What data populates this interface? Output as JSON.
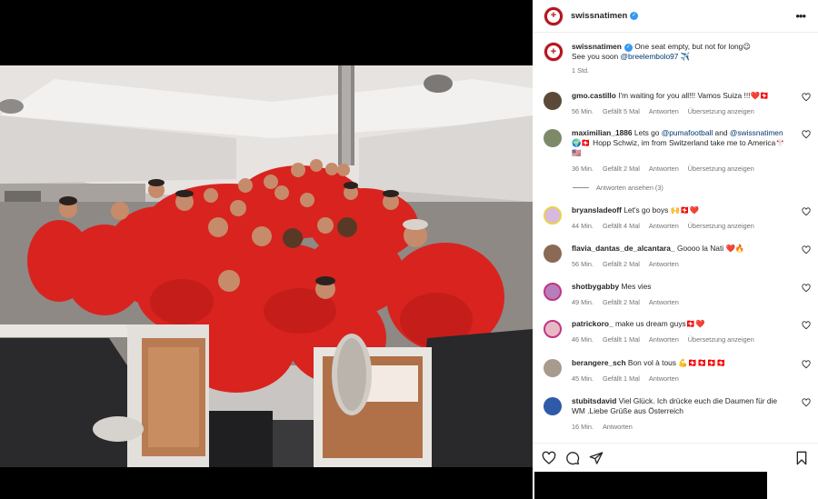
{
  "post": {
    "username": "swissnatimen",
    "caption_line1": "One seat empty, but not for long😉",
    "caption_line2_prefix": "See you soon ",
    "caption_mention": "@breelembolo97",
    "caption_line2_suffix": " ✈️",
    "time": "1 Std."
  },
  "comments": [
    {
      "user": "gmo.castillo",
      "text": "I'm waiting for you all!!! Vamos Suiza !!!❤️🇨🇭",
      "time": "56 Min.",
      "likes": "Gefällt 5 Mal",
      "reply": "Antworten",
      "translate": "Übersetzung anzeigen"
    },
    {
      "user": "maximilian_1886",
      "text_prefix": "Lets go ",
      "mention1": "@pumafootball",
      "text_mid": " and ",
      "mention2": "@swissnatimen",
      "text_suffix": " 🌍🇨🇭 Hopp Schwiz, im from Switzerland take me to America🎌🇺🇸",
      "time": "36 Min.",
      "likes": "Gefällt 2 Mal",
      "reply": "Antworten",
      "translate": "Übersetzung anzeigen",
      "replies_toggle": "Antworten ansehen (3)"
    },
    {
      "user": "bryansladeoff",
      "text": "Let's go boys 🙌🇨🇭❤️",
      "time": "44 Min.",
      "likes": "Gefällt 4 Mal",
      "reply": "Antworten",
      "translate": "Übersetzung anzeigen"
    },
    {
      "user": "flavia_dantas_de_alcantara_",
      "text": "Goooo la Nati ❤️🔥",
      "time": "56 Min.",
      "likes": "Gefällt 2 Mal",
      "reply": "Antworten"
    },
    {
      "user": "shotbygabby",
      "text": "Mes vies",
      "time": "49 Min.",
      "likes": "Gefällt 2 Mal",
      "reply": "Antworten"
    },
    {
      "user": "patrickoro_",
      "text": "make us dream guys🇨🇭❤️",
      "time": "46 Min.",
      "likes": "Gefällt 1 Mal",
      "reply": "Antworten",
      "translate": "Übersetzung anzeigen"
    },
    {
      "user": "berangere_sch",
      "text": "Bon vol à tous 💪🇨🇭🇨🇭🇨🇭🇨🇭",
      "time": "45 Min.",
      "likes": "Gefällt 1 Mal",
      "reply": "Antworten"
    },
    {
      "user": "stubitsdavid",
      "text": "Viel Glück. Ich drücke euch die Daumen für die WM .Liebe Grüße aus Österreich",
      "time": "16 Min.",
      "reply": "Antworten"
    }
  ],
  "icons": {
    "like": "heart-icon",
    "comment": "comment-icon",
    "share": "share-icon",
    "save": "bookmark-icon",
    "more": "more-options-icon",
    "verified": "verified-badge-icon"
  },
  "colors": {
    "jersey_red": "#d9231f",
    "link": "#00376b",
    "muted": "#737373",
    "verified": "#3897f0"
  }
}
